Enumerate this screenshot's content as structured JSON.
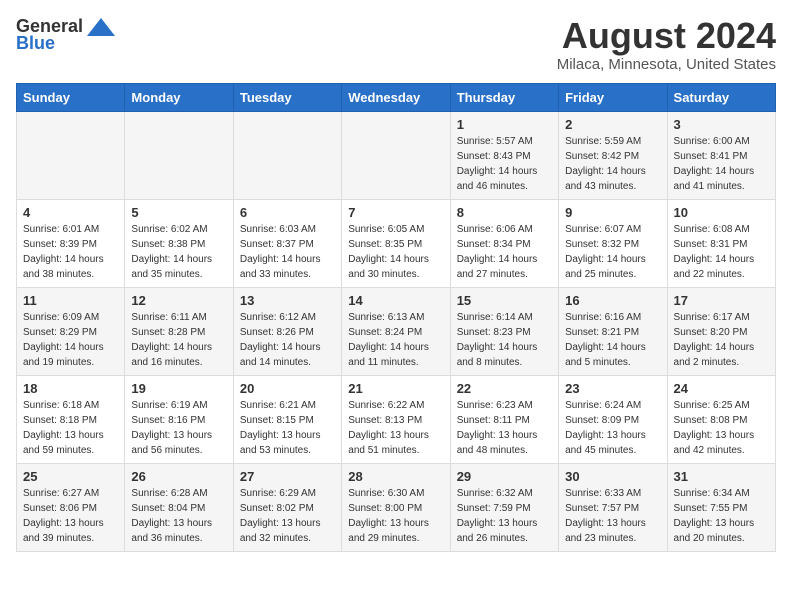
{
  "header": {
    "logo_general": "General",
    "logo_blue": "Blue",
    "title": "August 2024",
    "subtitle": "Milaca, Minnesota, United States"
  },
  "days_of_week": [
    "Sunday",
    "Monday",
    "Tuesday",
    "Wednesday",
    "Thursday",
    "Friday",
    "Saturday"
  ],
  "weeks": [
    [
      {
        "day": "",
        "info": ""
      },
      {
        "day": "",
        "info": ""
      },
      {
        "day": "",
        "info": ""
      },
      {
        "day": "",
        "info": ""
      },
      {
        "day": "1",
        "info": "Sunrise: 5:57 AM\nSunset: 8:43 PM\nDaylight: 14 hours\nand 46 minutes."
      },
      {
        "day": "2",
        "info": "Sunrise: 5:59 AM\nSunset: 8:42 PM\nDaylight: 14 hours\nand 43 minutes."
      },
      {
        "day": "3",
        "info": "Sunrise: 6:00 AM\nSunset: 8:41 PM\nDaylight: 14 hours\nand 41 minutes."
      }
    ],
    [
      {
        "day": "4",
        "info": "Sunrise: 6:01 AM\nSunset: 8:39 PM\nDaylight: 14 hours\nand 38 minutes."
      },
      {
        "day": "5",
        "info": "Sunrise: 6:02 AM\nSunset: 8:38 PM\nDaylight: 14 hours\nand 35 minutes."
      },
      {
        "day": "6",
        "info": "Sunrise: 6:03 AM\nSunset: 8:37 PM\nDaylight: 14 hours\nand 33 minutes."
      },
      {
        "day": "7",
        "info": "Sunrise: 6:05 AM\nSunset: 8:35 PM\nDaylight: 14 hours\nand 30 minutes."
      },
      {
        "day": "8",
        "info": "Sunrise: 6:06 AM\nSunset: 8:34 PM\nDaylight: 14 hours\nand 27 minutes."
      },
      {
        "day": "9",
        "info": "Sunrise: 6:07 AM\nSunset: 8:32 PM\nDaylight: 14 hours\nand 25 minutes."
      },
      {
        "day": "10",
        "info": "Sunrise: 6:08 AM\nSunset: 8:31 PM\nDaylight: 14 hours\nand 22 minutes."
      }
    ],
    [
      {
        "day": "11",
        "info": "Sunrise: 6:09 AM\nSunset: 8:29 PM\nDaylight: 14 hours\nand 19 minutes."
      },
      {
        "day": "12",
        "info": "Sunrise: 6:11 AM\nSunset: 8:28 PM\nDaylight: 14 hours\nand 16 minutes."
      },
      {
        "day": "13",
        "info": "Sunrise: 6:12 AM\nSunset: 8:26 PM\nDaylight: 14 hours\nand 14 minutes."
      },
      {
        "day": "14",
        "info": "Sunrise: 6:13 AM\nSunset: 8:24 PM\nDaylight: 14 hours\nand 11 minutes."
      },
      {
        "day": "15",
        "info": "Sunrise: 6:14 AM\nSunset: 8:23 PM\nDaylight: 14 hours\nand 8 minutes."
      },
      {
        "day": "16",
        "info": "Sunrise: 6:16 AM\nSunset: 8:21 PM\nDaylight: 14 hours\nand 5 minutes."
      },
      {
        "day": "17",
        "info": "Sunrise: 6:17 AM\nSunset: 8:20 PM\nDaylight: 14 hours\nand 2 minutes."
      }
    ],
    [
      {
        "day": "18",
        "info": "Sunrise: 6:18 AM\nSunset: 8:18 PM\nDaylight: 13 hours\nand 59 minutes."
      },
      {
        "day": "19",
        "info": "Sunrise: 6:19 AM\nSunset: 8:16 PM\nDaylight: 13 hours\nand 56 minutes."
      },
      {
        "day": "20",
        "info": "Sunrise: 6:21 AM\nSunset: 8:15 PM\nDaylight: 13 hours\nand 53 minutes."
      },
      {
        "day": "21",
        "info": "Sunrise: 6:22 AM\nSunset: 8:13 PM\nDaylight: 13 hours\nand 51 minutes."
      },
      {
        "day": "22",
        "info": "Sunrise: 6:23 AM\nSunset: 8:11 PM\nDaylight: 13 hours\nand 48 minutes."
      },
      {
        "day": "23",
        "info": "Sunrise: 6:24 AM\nSunset: 8:09 PM\nDaylight: 13 hours\nand 45 minutes."
      },
      {
        "day": "24",
        "info": "Sunrise: 6:25 AM\nSunset: 8:08 PM\nDaylight: 13 hours\nand 42 minutes."
      }
    ],
    [
      {
        "day": "25",
        "info": "Sunrise: 6:27 AM\nSunset: 8:06 PM\nDaylight: 13 hours\nand 39 minutes."
      },
      {
        "day": "26",
        "info": "Sunrise: 6:28 AM\nSunset: 8:04 PM\nDaylight: 13 hours\nand 36 minutes."
      },
      {
        "day": "27",
        "info": "Sunrise: 6:29 AM\nSunset: 8:02 PM\nDaylight: 13 hours\nand 32 minutes."
      },
      {
        "day": "28",
        "info": "Sunrise: 6:30 AM\nSunset: 8:00 PM\nDaylight: 13 hours\nand 29 minutes."
      },
      {
        "day": "29",
        "info": "Sunrise: 6:32 AM\nSunset: 7:59 PM\nDaylight: 13 hours\nand 26 minutes."
      },
      {
        "day": "30",
        "info": "Sunrise: 6:33 AM\nSunset: 7:57 PM\nDaylight: 13 hours\nand 23 minutes."
      },
      {
        "day": "31",
        "info": "Sunrise: 6:34 AM\nSunset: 7:55 PM\nDaylight: 13 hours\nand 20 minutes."
      }
    ]
  ]
}
